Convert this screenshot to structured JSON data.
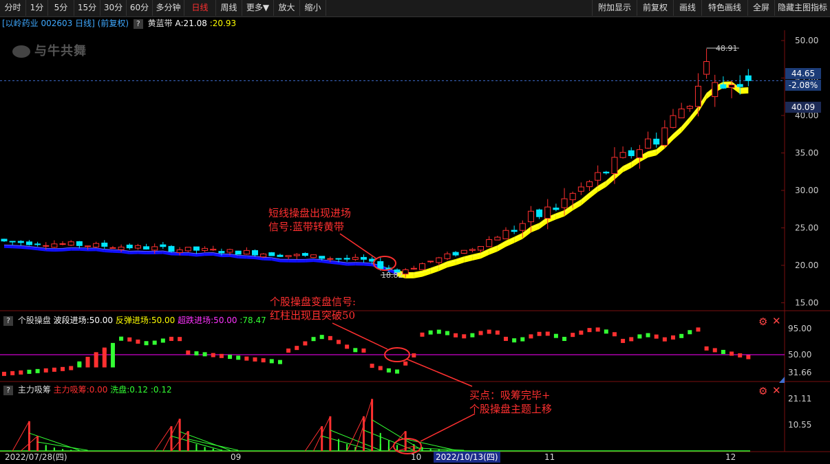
{
  "toolbar": {
    "left": [
      "分时",
      "1分",
      "5分",
      "15分",
      "30分",
      "60分",
      "多分钟",
      "日线",
      "周线",
      "更多▼",
      "放大",
      "缩小"
    ],
    "active": "日线",
    "right": [
      "附加显示",
      "前复权",
      "画线",
      "特色画线",
      "全屏",
      "隐藏主图指标"
    ]
  },
  "header": {
    "stock": "[以岭药业 002603 日线]",
    "adjust": "(前复权)",
    "help": "?",
    "indicator_label": "黄蓝带",
    "a_value": "A:21.08",
    "b_value": ":20.93"
  },
  "watermark": "与牛共舞",
  "price_axis": [
    "50.00",
    "45.00",
    "40.00",
    "35.00",
    "30.00",
    "25.00",
    "20.00",
    "15.00"
  ],
  "price_boxes": {
    "current": "44.65",
    "change": "-2.08%",
    "low": "40.09"
  },
  "labels": {
    "high": "48.91",
    "low": "18.82"
  },
  "panel2": {
    "name": "个股操盘",
    "item1": "波段进场:50.00",
    "item2": "反弹进场:50.00",
    "item3": "超跌进场:50.00",
    "item4": ":78.47",
    "axis": [
      "95.00",
      "50.00"
    ]
  },
  "panel3": {
    "name": "主力吸筹",
    "item1": "主力吸筹:0.00",
    "item2": "洗盘:0.12",
    "item3": ":0.12",
    "axis": [
      "31.66",
      "21.11",
      "10.55"
    ]
  },
  "dates": {
    "start": "2022/07/28(四)",
    "m09": "09",
    "m10": "10",
    "cursor": "2022/10/13(四)",
    "m11": "11",
    "m12": "12"
  },
  "annotations": {
    "a1_line1": "短线操盘出现进场",
    "a1_line2": "信号:蓝带转黄带",
    "a2_line1": "个股操盘变盘信号:",
    "a2_line2": "红柱出现且突破50",
    "a3_line1": "买点：吸筹完毕+",
    "a3_line2": "个股操盘主题上移"
  },
  "colors": {
    "up": "#ff3030",
    "down": "#00e5ff",
    "yellow": "#ffff00",
    "blue": "#1010ff",
    "magenta": "#ff00ff",
    "green": "#33ff33"
  }
}
